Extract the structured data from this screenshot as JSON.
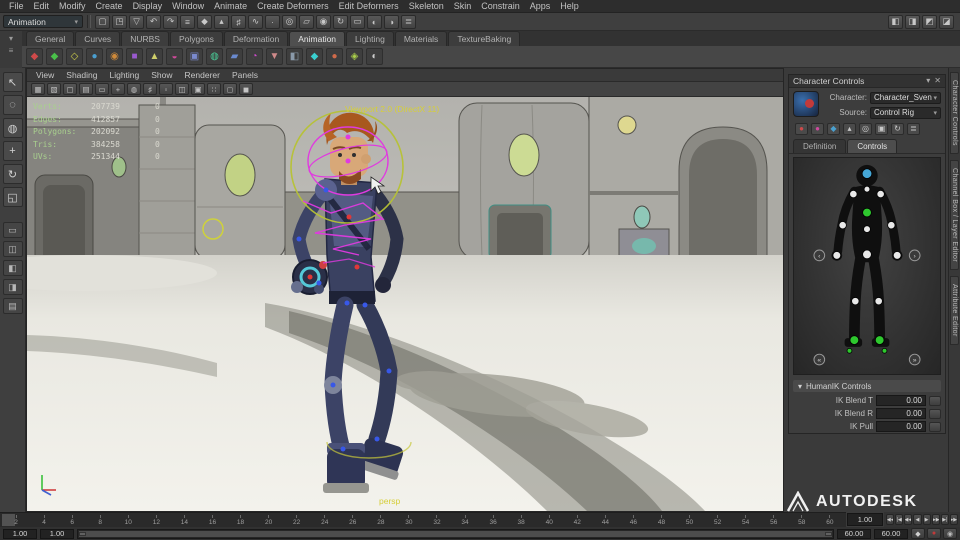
{
  "colors": {
    "accent": "#5285a6",
    "hud_label": "#a9d08e",
    "hud_value": "#dad9d0",
    "viewport_label": "#d6cf3a",
    "rig_magenta": "#e03ae0",
    "effector_green": "#2ec82e"
  },
  "menubar": {
    "items": [
      "File",
      "Edit",
      "Modify",
      "Create",
      "Display",
      "Window",
      "Animate",
      "Create Deformers",
      "Edit Deformers",
      "Skeleton",
      "Skin",
      "Constrain",
      "Apps",
      "Help"
    ]
  },
  "statusline": {
    "menu_set": "Animation",
    "icons": [
      {
        "name": "new-scene-icon",
        "glyph": "▢"
      },
      {
        "name": "open-scene-icon",
        "glyph": "◳"
      },
      {
        "name": "save-scene-icon",
        "glyph": "▽"
      },
      {
        "name": "undo-icon",
        "glyph": "↶"
      },
      {
        "name": "redo-icon",
        "glyph": "↷"
      },
      {
        "name": "select-hierarchy-icon",
        "glyph": "≡"
      },
      {
        "name": "select-object-icon",
        "glyph": "◆"
      },
      {
        "name": "select-component-icon",
        "glyph": "▴"
      },
      {
        "name": "snap-grid-icon",
        "glyph": "♯"
      },
      {
        "name": "snap-curve-icon",
        "glyph": "∿"
      },
      {
        "name": "snap-point-icon",
        "glyph": "∙"
      },
      {
        "name": "snap-center-icon",
        "glyph": "◎"
      },
      {
        "name": "snap-plane-icon",
        "glyph": "▱"
      },
      {
        "name": "make-live-icon",
        "glyph": "◉"
      },
      {
        "name": "history-icon",
        "glyph": "↻"
      },
      {
        "name": "render-view-icon",
        "glyph": "▭"
      },
      {
        "name": "render-frame-icon",
        "glyph": "◐"
      },
      {
        "name": "ipr-render-icon",
        "glyph": "◑"
      },
      {
        "name": "render-settings-icon",
        "glyph": "≣"
      }
    ],
    "right_icons": [
      {
        "name": "toggle-modeling-toolkit-icon",
        "glyph": "◧"
      },
      {
        "name": "toggle-attribute-editor-icon",
        "glyph": "◨"
      },
      {
        "name": "toggle-tool-settings-icon",
        "glyph": "◩"
      },
      {
        "name": "toggle-channel-box-icon",
        "glyph": "◪"
      }
    ]
  },
  "shelf": {
    "tabs": [
      "General",
      "Curves",
      "NURBS",
      "Polygons",
      "Deformation",
      "Animation",
      "Lighting",
      "Materials",
      "TextureBaking"
    ],
    "active_tab": "Animation",
    "tools": [
      {
        "name": "set-key-tool",
        "glyph": "◆",
        "color": "#cf4a4a"
      },
      {
        "name": "set-breakdown-tool",
        "glyph": "◆",
        "color": "#4ac04a"
      },
      {
        "name": "set-driven-key-tool",
        "glyph": "◇",
        "color": "#cfcf4a"
      },
      {
        "name": "ik-handle-tool",
        "glyph": "●",
        "color": "#4a9ecf"
      },
      {
        "name": "joint-tool",
        "glyph": "◉",
        "color": "#cf8a3a"
      },
      {
        "name": "constraint-tool",
        "glyph": "■",
        "color": "#9a5acf"
      },
      {
        "name": "motion-path-tool",
        "glyph": "▲",
        "color": "#cfcf6a"
      },
      {
        "name": "cluster-tool",
        "glyph": "◒",
        "color": "#cf4a9a"
      },
      {
        "name": "lattice-tool",
        "glyph": "▣",
        "color": "#7a8acf"
      },
      {
        "name": "blend-shape-tool",
        "glyph": "◍",
        "color": "#4acf9a"
      },
      {
        "name": "wrap-tool",
        "glyph": "▰",
        "color": "#6a8acf"
      },
      {
        "name": "wire-tool",
        "glyph": "◔",
        "color": "#cf4acf"
      },
      {
        "name": "sculpt-tool",
        "glyph": "▼",
        "color": "#cf8a8a"
      },
      {
        "name": "jiggle-tool",
        "glyph": "◧",
        "color": "#8a9aaa"
      },
      {
        "name": "nonlinear-tool",
        "glyph": "◆",
        "color": "#3acfcf"
      },
      {
        "name": "bend-tool",
        "glyph": "●",
        "color": "#cf6a4a"
      },
      {
        "name": "twist-tool",
        "glyph": "◈",
        "color": "#aacf4a"
      },
      {
        "name": "wave-tool",
        "glyph": "◐",
        "color": "#cccccc"
      }
    ]
  },
  "toolbox": {
    "tools": [
      {
        "name": "select-tool",
        "glyph": "↖"
      },
      {
        "name": "lasso-select-tool",
        "glyph": "◌"
      },
      {
        "name": "paint-select-tool",
        "glyph": "◍"
      },
      {
        "name": "move-tool",
        "glyph": "+"
      },
      {
        "name": "rotate-tool",
        "glyph": "↻"
      },
      {
        "name": "scale-tool",
        "glyph": "◱"
      }
    ],
    "layouts": [
      {
        "name": "single-pane-layout",
        "glyph": "▭"
      },
      {
        "name": "four-pane-layout",
        "glyph": "◫"
      },
      {
        "name": "persp-outliner-layout",
        "glyph": "◧"
      },
      {
        "name": "stacked-pane-layout",
        "glyph": "◨"
      },
      {
        "name": "persp-graph-layout",
        "glyph": "▤"
      }
    ]
  },
  "viewport": {
    "menu": [
      "View",
      "Shading",
      "Lighting",
      "Show",
      "Renderer",
      "Panels"
    ],
    "toolbar_icons": [
      {
        "name": "select-camera-icon",
        "glyph": "▦"
      },
      {
        "name": "lock-camera-icon",
        "glyph": "▧"
      },
      {
        "name": "camera-attributes-icon",
        "glyph": "▢"
      },
      {
        "name": "bookmarks-icon",
        "glyph": "▤"
      },
      {
        "name": "image-plane-icon",
        "glyph": "▭"
      },
      {
        "name": "2d-pan-zoom-icon",
        "glyph": "+"
      },
      {
        "name": "grease-pencil-icon",
        "glyph": "◍"
      },
      {
        "name": "grid-toggle-icon",
        "glyph": "♯"
      },
      {
        "name": "film-gate-icon",
        "glyph": "▫"
      },
      {
        "name": "resolution-gate-icon",
        "glyph": "◫"
      },
      {
        "name": "gate-mask-icon",
        "glyph": "▣"
      },
      {
        "name": "field-chart-icon",
        "glyph": "∷"
      },
      {
        "name": "safe-action-icon",
        "glyph": "◻"
      },
      {
        "name": "safe-title-icon",
        "glyph": "◼"
      }
    ],
    "renderer_label": "Viewport 2.0 (DirectX 11)",
    "camera_label": "persp",
    "hud_rows": [
      {
        "label": "Verts:",
        "total": "207739",
        "selected": "0"
      },
      {
        "label": "Edges:",
        "total": "412857",
        "selected": "0"
      },
      {
        "label": "Polygons:",
        "total": "202092",
        "selected": "0"
      },
      {
        "label": "Tris:",
        "total": "384258",
        "selected": "0"
      },
      {
        "label": "UVs:",
        "total": "251344",
        "selected": "0"
      }
    ]
  },
  "character_panel": {
    "title": "Character Controls",
    "character_label": "Character:",
    "character_value": "Character_Sven",
    "source_label": "Source:",
    "source_value": "Control Rig",
    "toolbar_icons": [
      {
        "name": "full-body-key-icon",
        "glyph": "●",
        "color": "#cf4a4a"
      },
      {
        "name": "body-part-key-icon",
        "glyph": "●",
        "color": "#cf4aa0"
      },
      {
        "name": "selection-key-icon",
        "glyph": "◆",
        "color": "#4aa0cf"
      },
      {
        "name": "stance-pose-icon",
        "glyph": "▴",
        "color": "#c8c8c8"
      },
      {
        "name": "pin-translate-icon",
        "glyph": "◎",
        "color": "#c8c8c8"
      },
      {
        "name": "pin-rotate-icon",
        "glyph": "▣",
        "color": "#c8c8c8"
      },
      {
        "name": "mirror-icon",
        "glyph": "↻",
        "color": "#c8c8c8"
      },
      {
        "name": "hik-menu-icon",
        "glyph": "≣",
        "color": "#c8c8c8"
      }
    ],
    "tabs": [
      "Definition",
      "Controls"
    ],
    "active_tab": "Controls",
    "section_title": "HumanIK Controls",
    "fields": [
      {
        "label": "IK Blend T",
        "value": "0.00"
      },
      {
        "label": "IK Blend R",
        "value": "0.00"
      },
      {
        "label": "IK Pull",
        "value": "0.00"
      }
    ]
  },
  "right_dock_tabs": [
    "Character Controls",
    "Channel Box / Layer Editor",
    "Attribute Editor"
  ],
  "watermark": {
    "text": "AUTODESK"
  },
  "timeline": {
    "ticks": [
      "2",
      "4",
      "6",
      "8",
      "10",
      "12",
      "14",
      "16",
      "18",
      "20",
      "22",
      "24",
      "26",
      "28",
      "30",
      "32",
      "34",
      "36",
      "38",
      "40",
      "42",
      "44",
      "46",
      "48",
      "50",
      "52",
      "54",
      "56",
      "58",
      "60"
    ],
    "current_time": "1.00",
    "playback_buttons": [
      {
        "name": "go-to-start-button",
        "glyph": "|◀◀"
      },
      {
        "name": "step-back-key-button",
        "glyph": "|◀"
      },
      {
        "name": "step-back-frame-button",
        "glyph": "◀◀"
      },
      {
        "name": "play-backwards-button",
        "glyph": "◀"
      },
      {
        "name": "play-forwards-button",
        "glyph": "▶"
      },
      {
        "name": "step-forward-frame-button",
        "glyph": "▶▶"
      },
      {
        "name": "step-forward-key-button",
        "glyph": "▶|"
      },
      {
        "name": "go-to-end-button",
        "glyph": "▶▶|"
      }
    ]
  },
  "range_bar": {
    "animation_start": "1.00",
    "playback_start": "1.00",
    "playback_end": "60.00",
    "animation_end": "60.00",
    "buttons": [
      {
        "name": "set-key-button",
        "glyph": "◆",
        "color": "#d0d0d0"
      },
      {
        "name": "auto-keyframe-toggle",
        "glyph": "●",
        "color": "#c23a3a"
      },
      {
        "name": "animation-preferences-button",
        "glyph": "◉",
        "color": "#bdbdbd"
      }
    ]
  }
}
